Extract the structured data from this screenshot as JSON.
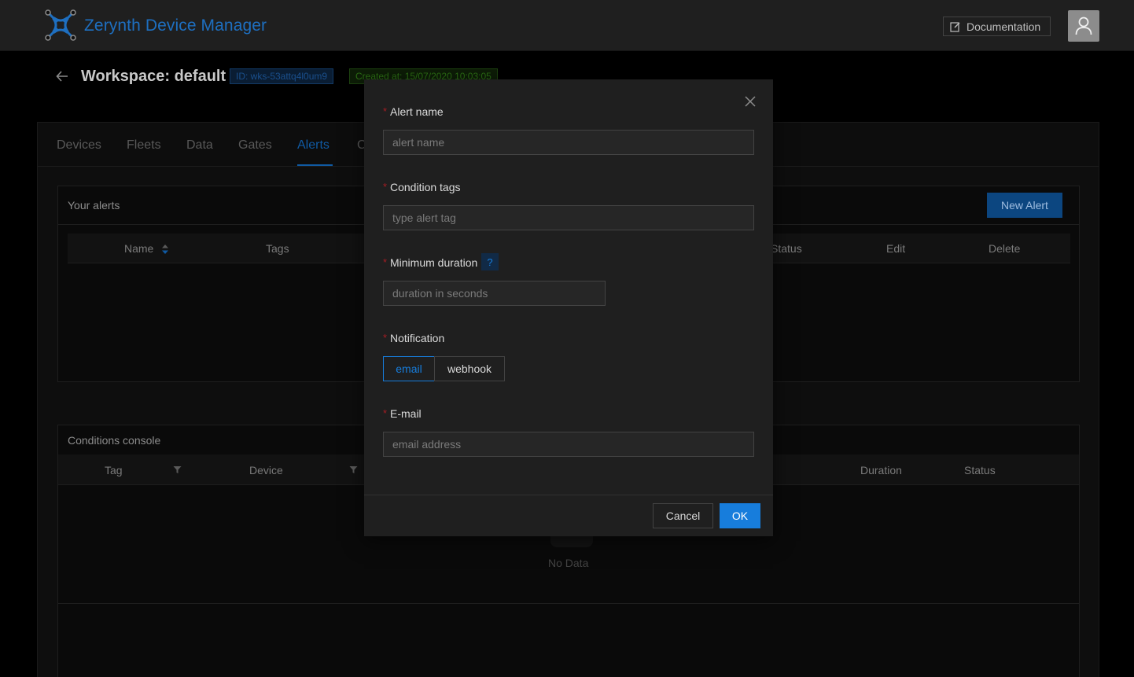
{
  "header": {
    "brand": "Zerynth Device Manager",
    "documentation_label": "Documentation"
  },
  "workspace": {
    "title": "Workspace: default",
    "id_tag": "ID: wks-53attq4l0um9",
    "created_tag": "Created at: 15/07/2020 10:03:05"
  },
  "tabs": [
    {
      "label": "Devices"
    },
    {
      "label": "Fleets"
    },
    {
      "label": "Data"
    },
    {
      "label": "Gates"
    },
    {
      "label": "Alerts"
    },
    {
      "label": "C"
    }
  ],
  "alerts_card": {
    "title": "Your alerts",
    "new_alert_label": "New Alert",
    "columns": [
      "Name",
      "Tags",
      "Status",
      "Edit",
      "Delete"
    ]
  },
  "conditions_card": {
    "title": "Conditions console",
    "columns": [
      "Tag",
      "Device",
      "Duration",
      "Status"
    ],
    "empty_text": "No Data"
  },
  "modal": {
    "alert_name_label": "Alert name",
    "alert_name_placeholder": "alert name",
    "condition_tags_label": "Condition tags",
    "condition_tags_placeholder": "type alert tag",
    "min_duration_label": "Minimum duration",
    "help_mark": "?",
    "min_duration_placeholder": "duration in seconds",
    "notification_label": "Notification",
    "notification_options": [
      "email",
      "webhook"
    ],
    "email_label": "E-mail",
    "email_placeholder": "email address",
    "cancel_label": "Cancel",
    "ok_label": "OK"
  },
  "colors": {
    "accent": "#177ddc",
    "brand": "#1e6fc0",
    "required": "#a61d24"
  }
}
